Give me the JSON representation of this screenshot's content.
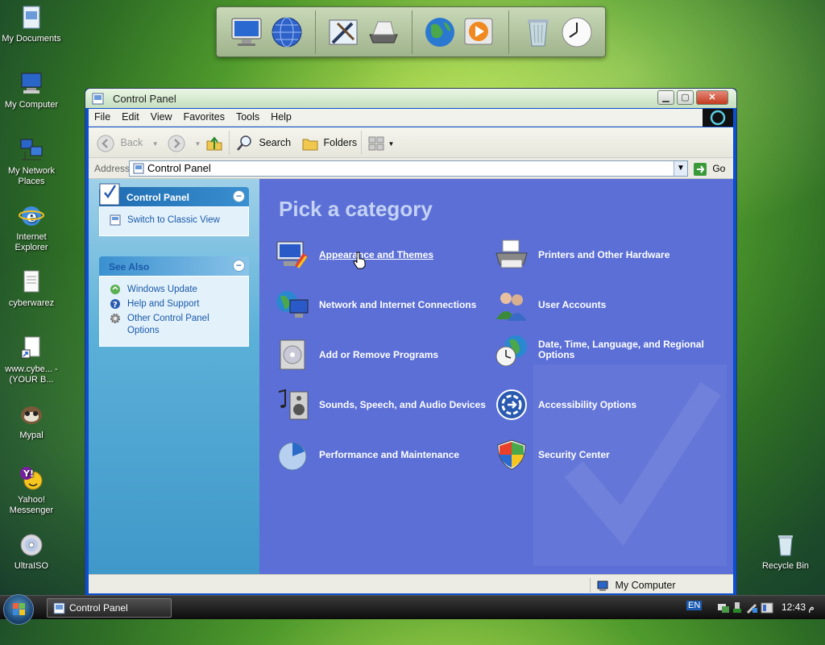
{
  "desktop": {
    "icons": [
      {
        "label": "My Documents",
        "icon": "my-documents-icon"
      },
      {
        "label": "My Computer",
        "icon": "my-computer-icon"
      },
      {
        "label": "My Network Places",
        "icon": "network-places-icon"
      },
      {
        "label": "Internet Explorer",
        "icon": "internet-explorer-icon"
      },
      {
        "label": "cyberwarez",
        "icon": "text-document-icon"
      },
      {
        "label": "www.cybe... - (YOUR B...",
        "icon": "shortcut-icon"
      },
      {
        "label": "Mypal",
        "icon": "mypal-icon"
      },
      {
        "label": "Yahoo! Messenger",
        "icon": "yahoo-messenger-icon"
      },
      {
        "label": "UltraISO",
        "icon": "ultraiso-icon"
      },
      {
        "label": "Recycle Bin",
        "icon": "recycle-bin-icon"
      }
    ]
  },
  "dock": {
    "items": [
      "monitor-icon",
      "network-globe-icon",
      "pen-tools-icon",
      "scanner-icon",
      "internet-globe-icon",
      "media-player-icon",
      "trash-icon",
      "clock-icon"
    ]
  },
  "window": {
    "title": "Control Panel",
    "menu": [
      "File",
      "Edit",
      "View",
      "Favorites",
      "Tools",
      "Help"
    ],
    "toolbar": {
      "back": "Back",
      "search": "Search",
      "folders": "Folders"
    },
    "address": {
      "label": "Address",
      "value": "Control Panel",
      "go": "Go"
    },
    "left_panels": {
      "control_panel": {
        "title": "Control Panel",
        "links": [
          "Switch to Classic View"
        ]
      },
      "see_also": {
        "title": "See Also",
        "links": [
          "Windows Update",
          "Help and Support",
          "Other Control Panel Options"
        ]
      }
    },
    "main": {
      "heading": "Pick a category",
      "categories": [
        {
          "label": "Appearance and Themes",
          "icon": "appearance-themes-icon"
        },
        {
          "label": "Printers and Other Hardware",
          "icon": "printer-icon"
        },
        {
          "label": "Network and Internet Connections",
          "icon": "network-connections-icon"
        },
        {
          "label": "User Accounts",
          "icon": "user-accounts-icon"
        },
        {
          "label": "Add or Remove Programs",
          "icon": "add-remove-programs-icon"
        },
        {
          "label": "Date, Time, Language, and Regional Options",
          "icon": "date-time-icon"
        },
        {
          "label": "Sounds, Speech, and Audio Devices",
          "icon": "sounds-icon"
        },
        {
          "label": "Accessibility Options",
          "icon": "accessibility-icon"
        },
        {
          "label": "Performance and Maintenance",
          "icon": "performance-icon"
        },
        {
          "label": "Security Center",
          "icon": "security-shield-icon"
        }
      ]
    },
    "status": "My Computer"
  },
  "taskbar": {
    "task": "Control Panel",
    "language": "EN",
    "clock": "12:43 م"
  }
}
